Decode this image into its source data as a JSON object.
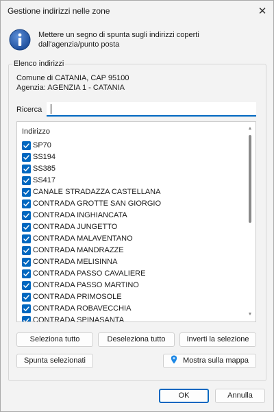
{
  "window": {
    "title": "Gestione indirizzi nelle zone",
    "close_symbol": "✕"
  },
  "info": {
    "icon": "info-icon",
    "text_line1": "Mettere un segno di spunta sugli indirizzi coperti",
    "text_line2": "dall'agenzia/punto posta"
  },
  "group": {
    "legend": "Elenco indirizzi",
    "line1": "Comune di CATANIA, CAP 95100",
    "line2": "Agenzia: AGENZIA 1 - CATANIA"
  },
  "search": {
    "label": "Ricerca",
    "value": ""
  },
  "list": {
    "header": "Indirizzo",
    "items": [
      {
        "label": "SP70",
        "checked": true
      },
      {
        "label": "SS194",
        "checked": true
      },
      {
        "label": "SS385",
        "checked": true
      },
      {
        "label": "SS417",
        "checked": true
      },
      {
        "label": "CANALE STRADAZZA CASTELLANA",
        "checked": true
      },
      {
        "label": "CONTRADA GROTTE SAN GIORGIO",
        "checked": true
      },
      {
        "label": "CONTRADA INGHIANCATA",
        "checked": true
      },
      {
        "label": "CONTRADA JUNGETTO",
        "checked": true
      },
      {
        "label": "CONTRADA MALAVENTANO",
        "checked": true
      },
      {
        "label": "CONTRADA MANDRAZZE",
        "checked": true
      },
      {
        "label": "CONTRADA MELISINNA",
        "checked": true
      },
      {
        "label": "CONTRADA PASSO CAVALIERE",
        "checked": true
      },
      {
        "label": "CONTRADA PASSO MARTINO",
        "checked": true
      },
      {
        "label": "CONTRADA PRIMOSOLE",
        "checked": true
      },
      {
        "label": "CONTRADA ROBAVECCHIA",
        "checked": true
      },
      {
        "label": "CONTRADA SPINASANTA",
        "checked": true
      }
    ]
  },
  "buttons": {
    "select_all": "Seleziona tutto",
    "deselect_all": "Deseleziona tutto",
    "invert": "Inverti la selezione",
    "check_selected": "Spunta selezionati",
    "show_map": "Mostra sulla mappa",
    "ok": "OK",
    "cancel": "Annulla"
  },
  "colors": {
    "accent": "#0067c0",
    "window_bg": "#f3f3f3",
    "map_pin": "#1e88e5"
  }
}
